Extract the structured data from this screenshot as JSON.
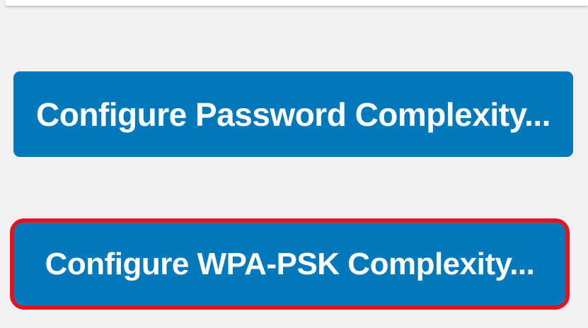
{
  "buttons": {
    "password_complexity": "Configure Password Complexity...",
    "wpa_psk_complexity": "Configure WPA-PSK Complexity..."
  },
  "colors": {
    "button_background": "#0378bb",
    "button_text": "#ffffff",
    "highlight_outline": "#e3141b",
    "panel_background": "#f1f1f3"
  },
  "highlighted_button": "wpa_psk_complexity"
}
